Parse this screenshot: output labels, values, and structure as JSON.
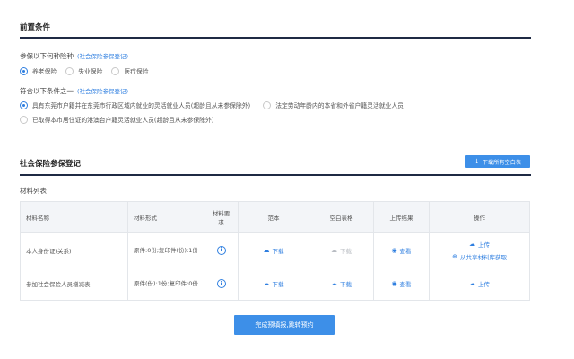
{
  "section1": {
    "title": "前置条件",
    "insurance": {
      "label": "参保以下何种险种",
      "link": "(社会保险参保登记)",
      "options": [
        "养老保险",
        "失业保险",
        "医疗保险"
      ]
    },
    "conditions": {
      "label": "符合以下条件之一",
      "link": "(社会保险参保登记)",
      "options": [
        "具有东莞市户籍并在东莞市行政区域内就业的灵活就业人员(超龄且从未参保除外)",
        "法定劳动年龄内的本省和外省户籍灵活就业人员",
        "已取得本市居住证的港澳台户籍灵活就业人员(超龄且从未参保除外)"
      ]
    }
  },
  "section2": {
    "title": "社会保险参保登记",
    "download_all": "下载所有空白表",
    "materials_label": "材料列表"
  },
  "table": {
    "headers": [
      "材料名称",
      "材料形式",
      "材料要求",
      "范本",
      "空白表格",
      "上传结果",
      "操作"
    ],
    "rows": [
      {
        "name": "本人身份证(关系)",
        "form": "原件:0份;复印件(份):1份",
        "sample": "下载",
        "blank": "下载",
        "result": "查看",
        "upload": "上传",
        "shared": "从共享材料库获取"
      },
      {
        "name": "参加社会保险人员增减表",
        "form": "原件(份):1份;复印件:0份",
        "sample": "下载",
        "blank": "下载",
        "result": "查看",
        "upload": "上传"
      }
    ],
    "info_icon": "i"
  },
  "submit": "完成预填报,跳转预约",
  "icons": {
    "download": "↓",
    "cloud_download": "☁",
    "view": "◉",
    "upload": "☁",
    "shared": "⊕"
  }
}
